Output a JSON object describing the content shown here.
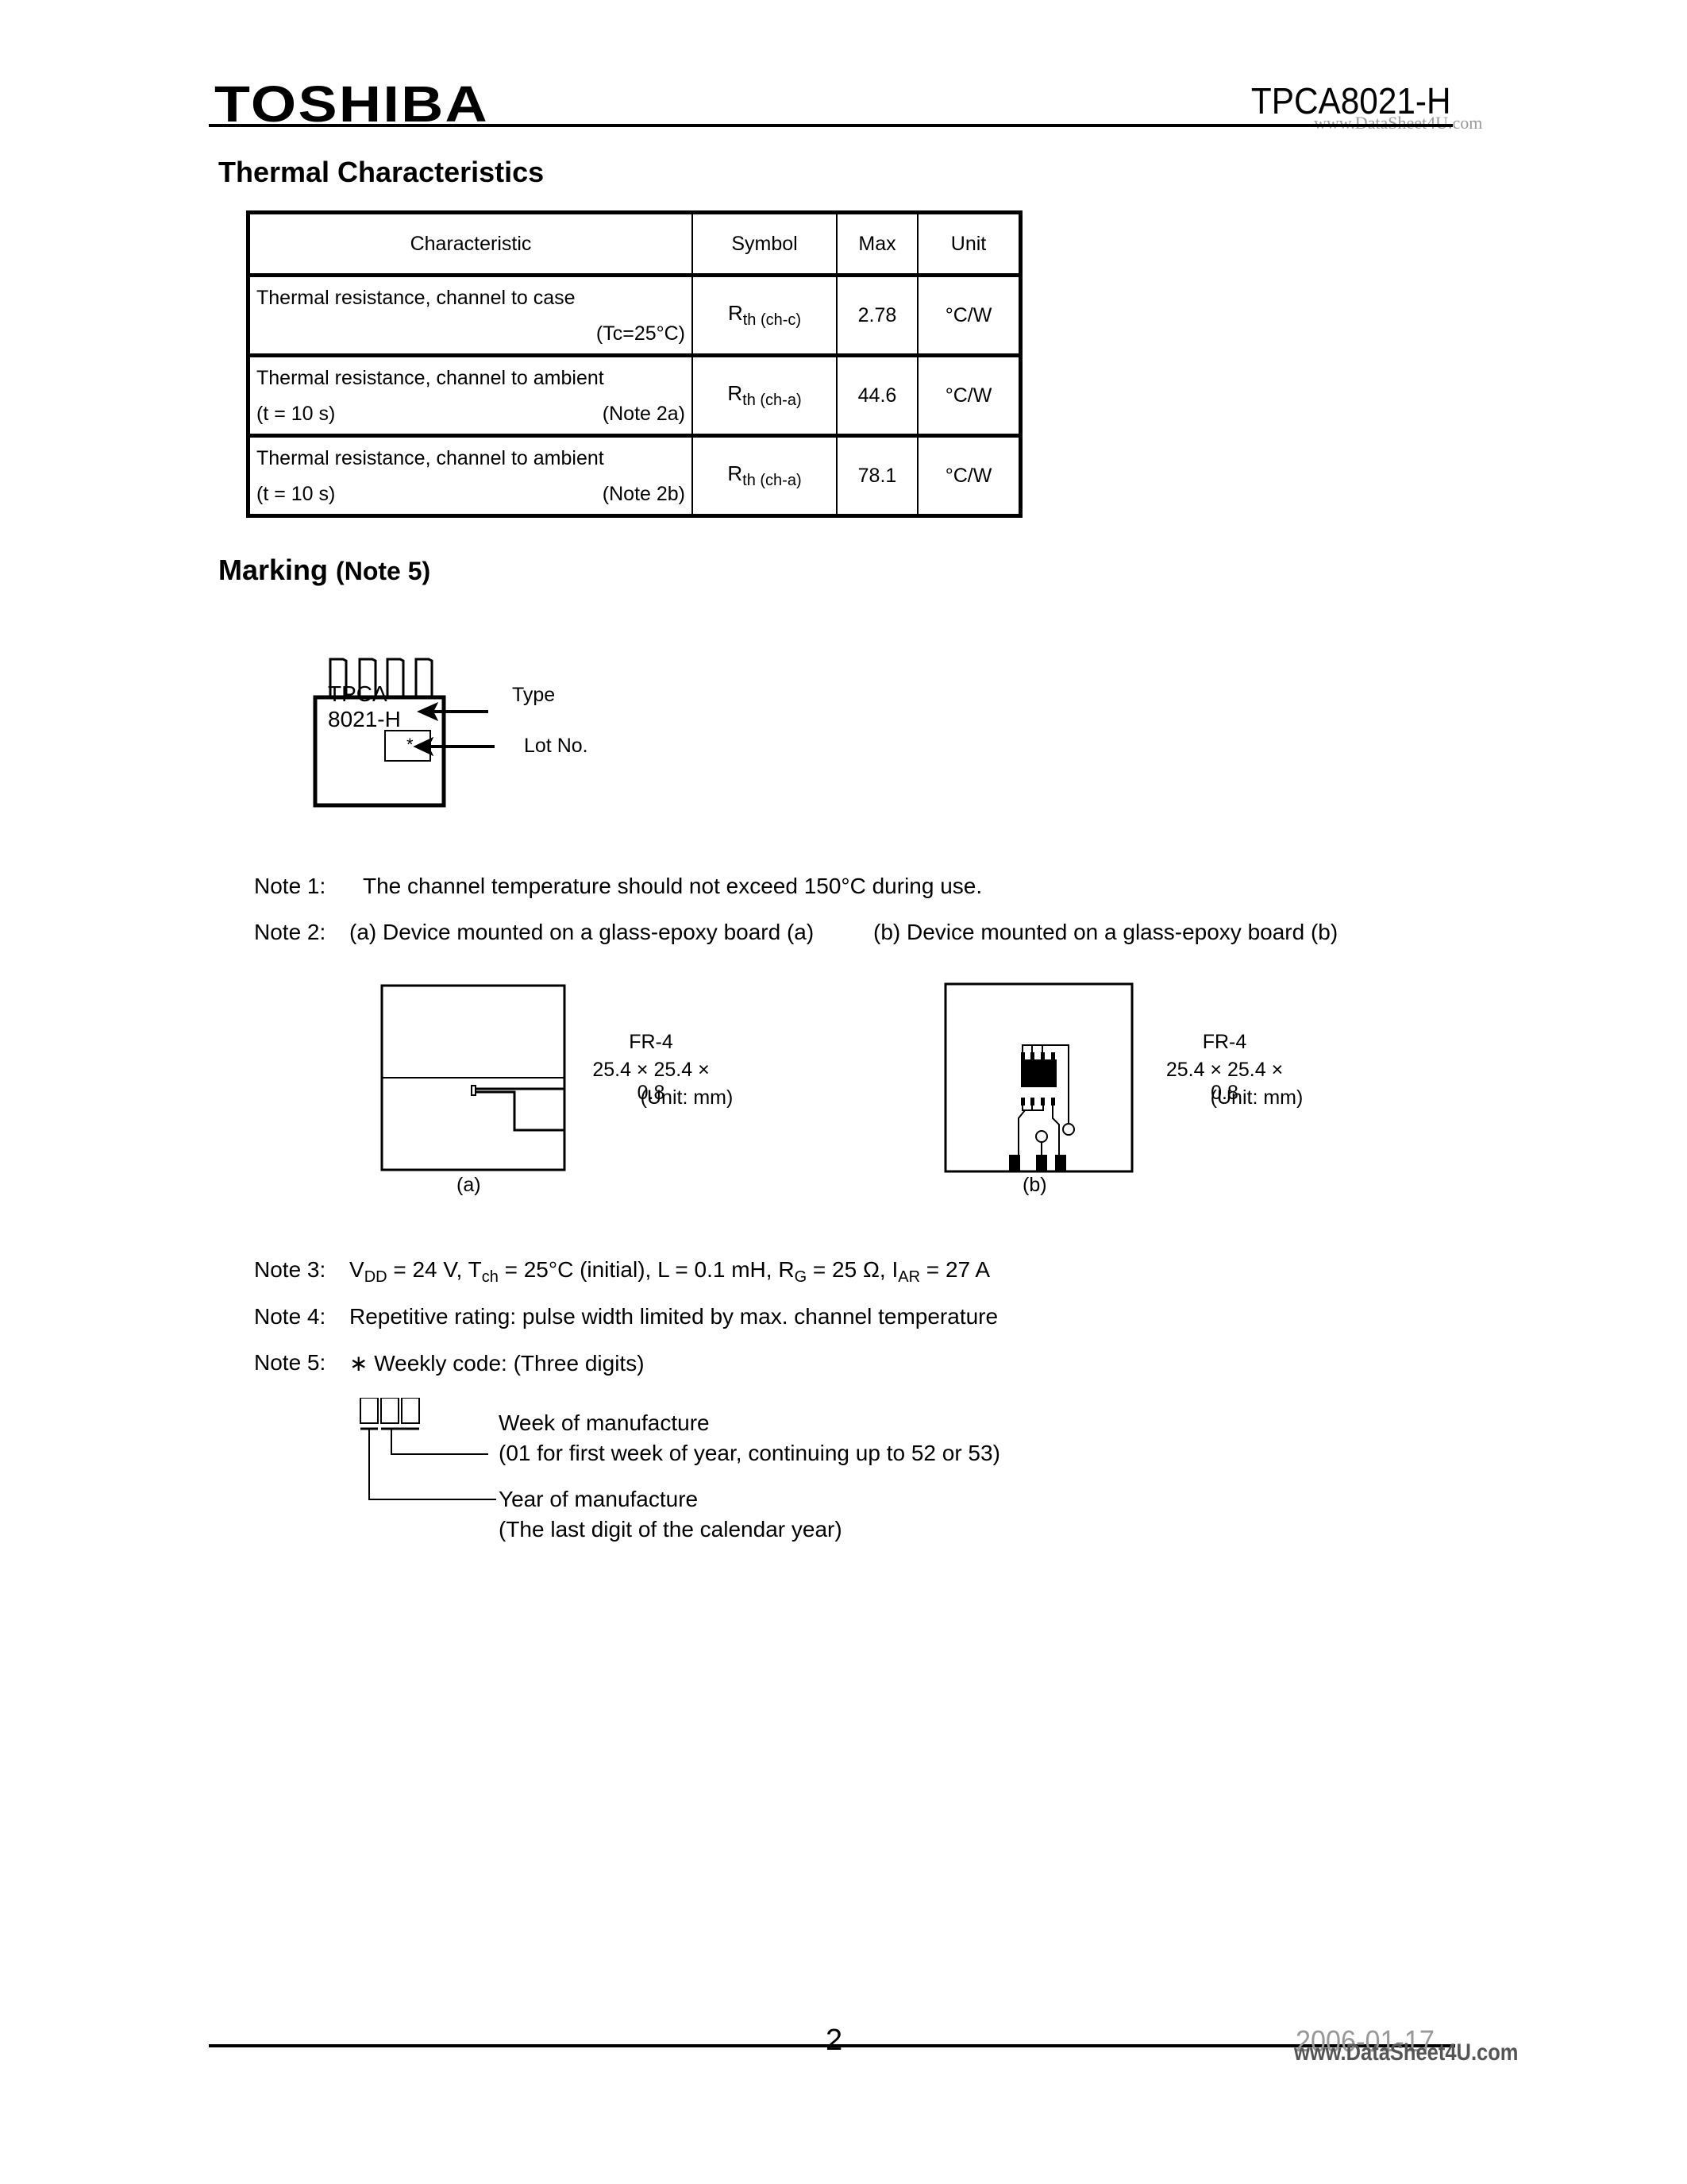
{
  "header": {
    "brand": "TOSHIBA",
    "part_number": "TPCA8021-H",
    "watermark": "www.DataSheet4U.com"
  },
  "thermal": {
    "title": "Thermal Characteristics",
    "columns": [
      "Characteristic",
      "Symbol",
      "Max",
      "Unit"
    ],
    "rows": [
      {
        "line1": "Thermal resistance, channel to case",
        "line2_left": "",
        "line2_right": "(Tc=25°C)",
        "symbol_main": "R",
        "symbol_sub": "th (ch-c)",
        "max": "2.78",
        "unit": "°C/W"
      },
      {
        "line1": "Thermal resistance, channel to ambient",
        "line2_left": "(t = 10 s)",
        "line2_right": "(Note 2a)",
        "symbol_main": "R",
        "symbol_sub": "th (ch-a)",
        "max": "44.6",
        "unit": "°C/W"
      },
      {
        "line1": "Thermal resistance, channel to ambient",
        "line2_left": "(t = 10 s)",
        "line2_right": "(Note 2b)",
        "symbol_main": "R",
        "symbol_sub": "th (ch-a)",
        "max": "78.1",
        "unit": "°C/W"
      }
    ]
  },
  "marking": {
    "title": "Marking",
    "title_note": "(Note 5)",
    "chip_line1": "TPCA",
    "chip_line2": "8021-H",
    "lot_mark": "*",
    "type_label": "Type",
    "lot_label": "Lot No."
  },
  "notes": {
    "note1": {
      "label": "Note 1:",
      "text": "The channel temperature should not exceed 150°C during use."
    },
    "note2": {
      "label": "Note 2:",
      "text_a": "(a) Device mounted on a glass-epoxy board (a)",
      "text_b": "(b) Device mounted on a glass-epoxy board (b)"
    },
    "board_a": {
      "material": "FR-4",
      "dims": "25.4 × 25.4 × 0.8",
      "unit": "(Unit: mm)",
      "caption": "(a)"
    },
    "board_b": {
      "material": "FR-4",
      "dims": "25.4 × 25.4 × 0.8",
      "unit": "(Unit: mm)",
      "caption": "(b)"
    },
    "note3": {
      "label": "Note 3:",
      "vdd_main": "V",
      "vdd_sub": "DD",
      "vdd_val": " = 24 V, ",
      "tch_main": "T",
      "tch_sub": "ch",
      "tch_val": " = 25°C (initial), L = 0.1 mH, ",
      "rg_main": "R",
      "rg_sub": "G",
      "rg_val": " = 25 Ω, ",
      "iar_main": "I",
      "iar_sub": "AR",
      "iar_val": " = 27 A"
    },
    "note4": {
      "label": "Note 4:",
      "text": "Repetitive rating: pulse width limited by max. channel temperature"
    },
    "note5": {
      "label": "Note 5:",
      "text": "∗ Weekly code:  (Three digits)",
      "week_title": "Week of manufacture",
      "week_desc": "(01 for first week of year, continuing up to 52 or 53)",
      "year_title": "Year of manufacture",
      "year_desc": "(The last digit of the calendar year)"
    }
  },
  "footer": {
    "page_number": "2",
    "date": "2006-01-17",
    "watermark": "www.DataSheet4U.com"
  }
}
